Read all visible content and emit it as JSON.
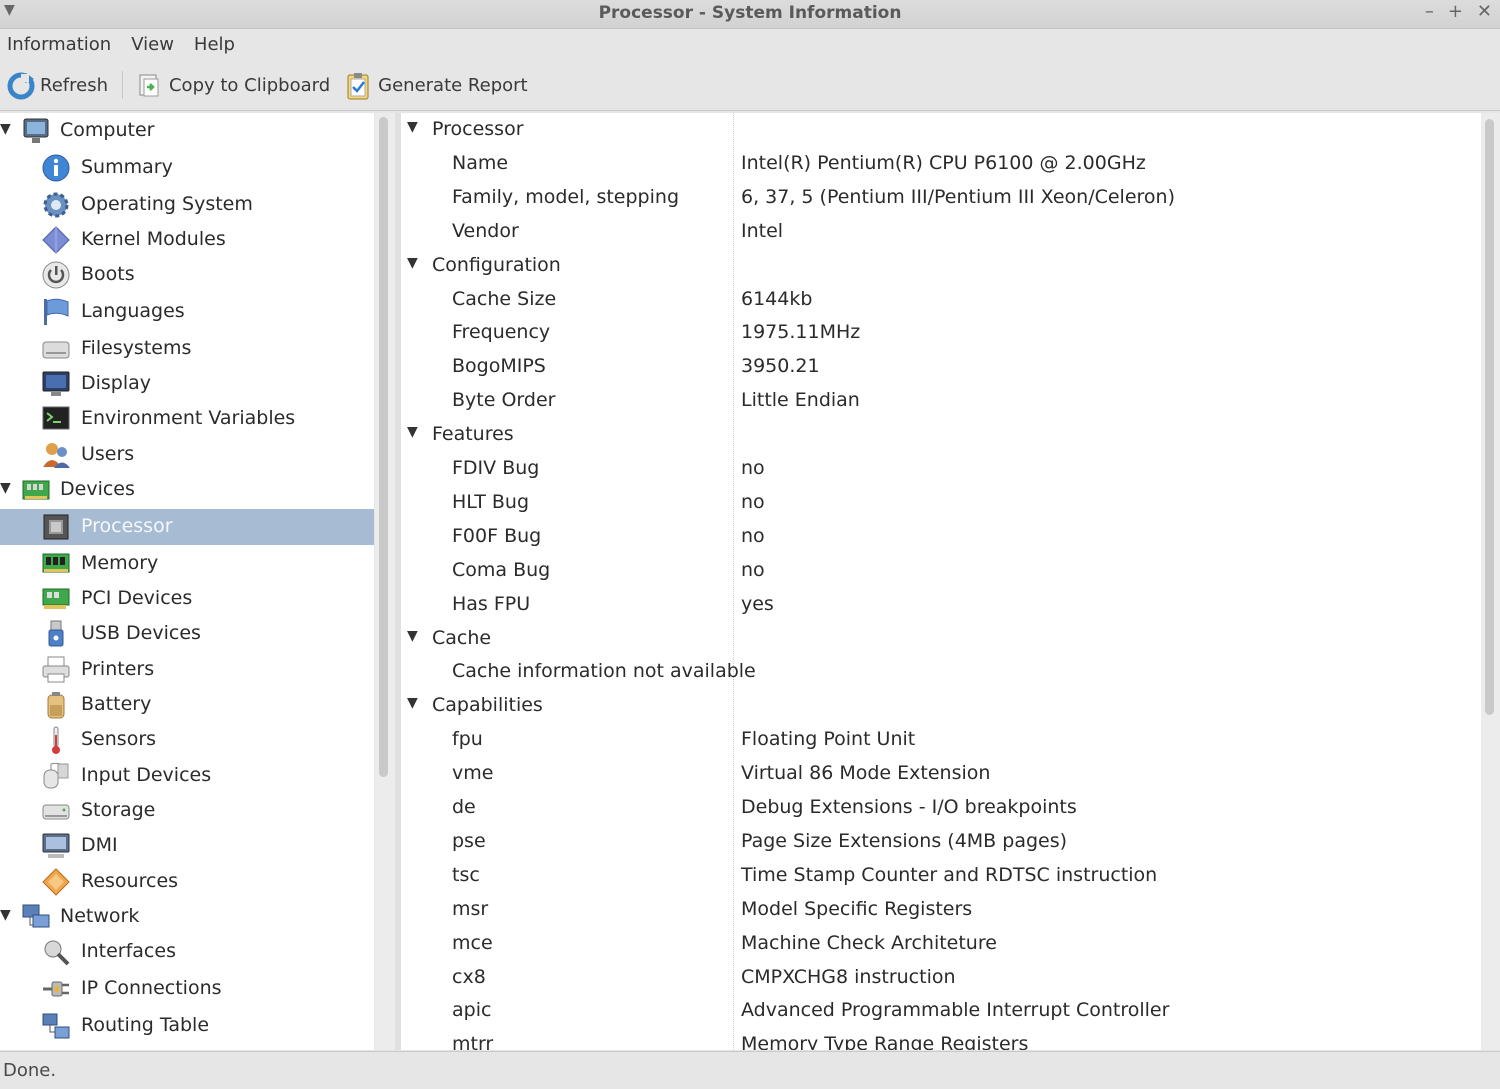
{
  "window": {
    "title": "Processor - System Information",
    "minimize": "–",
    "maximize": "+",
    "close": "✕"
  },
  "menu": [
    "Information",
    "View",
    "Help"
  ],
  "toolbar": {
    "refresh": "Refresh",
    "copy": "Copy to Clipboard",
    "report": "Generate Report"
  },
  "tree": [
    {
      "label": "Computer",
      "icon": "monitor-icon",
      "level": 0,
      "expanded": true
    },
    {
      "label": "Summary",
      "icon": "info-icon",
      "level": 1
    },
    {
      "label": "Operating System",
      "icon": "gear-icon",
      "level": 1
    },
    {
      "label": "Kernel Modules",
      "icon": "diamond-icon",
      "level": 1
    },
    {
      "label": "Boots",
      "icon": "power-icon",
      "level": 1
    },
    {
      "label": "Languages",
      "icon": "flag-icon",
      "level": 1
    },
    {
      "label": "Filesystems",
      "icon": "drive-icon",
      "level": 1
    },
    {
      "label": "Display",
      "icon": "display-icon",
      "level": 1
    },
    {
      "label": "Environment Variables",
      "icon": "terminal-icon",
      "level": 1
    },
    {
      "label": "Users",
      "icon": "users-icon",
      "level": 1
    },
    {
      "label": "Devices",
      "icon": "board-icon",
      "level": 0,
      "expanded": true
    },
    {
      "label": "Processor",
      "icon": "cpu-icon",
      "level": 1,
      "selected": true
    },
    {
      "label": "Memory",
      "icon": "memory-icon",
      "level": 1
    },
    {
      "label": "PCI Devices",
      "icon": "pci-icon",
      "level": 1
    },
    {
      "label": "USB Devices",
      "icon": "usb-icon",
      "level": 1
    },
    {
      "label": "Printers",
      "icon": "printer-icon",
      "level": 1
    },
    {
      "label": "Battery",
      "icon": "battery-icon",
      "level": 1
    },
    {
      "label": "Sensors",
      "icon": "thermometer-icon",
      "level": 1
    },
    {
      "label": "Input Devices",
      "icon": "input-device-icon",
      "level": 1
    },
    {
      "label": "Storage",
      "icon": "storage-icon",
      "level": 1
    },
    {
      "label": "DMI",
      "icon": "dmi-icon",
      "level": 1
    },
    {
      "label": "Resources",
      "icon": "resources-icon",
      "level": 1
    },
    {
      "label": "Network",
      "icon": "network-icon",
      "level": 0,
      "expanded": true
    },
    {
      "label": "Interfaces",
      "icon": "interfaces-icon",
      "level": 1
    },
    {
      "label": "IP Connections",
      "icon": "plug-icon",
      "level": 1
    },
    {
      "label": "Routing Table",
      "icon": "routing-icon",
      "level": 1
    }
  ],
  "details": [
    {
      "section": "Processor"
    },
    {
      "key": "Name",
      "value": "Intel(R) Pentium(R) CPU        P6100  @ 2.00GHz"
    },
    {
      "key": "Family, model, stepping",
      "value": "6, 37, 5 (Pentium III/Pentium III Xeon/Celeron)"
    },
    {
      "key": "Vendor",
      "value": "Intel"
    },
    {
      "section": "Configuration"
    },
    {
      "key": "Cache Size",
      "value": "6144kb"
    },
    {
      "key": "Frequency",
      "value": "1975.11MHz"
    },
    {
      "key": "BogoMIPS",
      "value": "3950.21"
    },
    {
      "key": "Byte Order",
      "value": "Little Endian"
    },
    {
      "section": "Features"
    },
    {
      "key": "FDIV Bug",
      "value": "no"
    },
    {
      "key": "HLT Bug",
      "value": "no"
    },
    {
      "key": "F00F Bug",
      "value": "no"
    },
    {
      "key": "Coma Bug",
      "value": "no"
    },
    {
      "key": "Has FPU",
      "value": "yes"
    },
    {
      "section": "Cache"
    },
    {
      "key": "Cache information not available",
      "value": ""
    },
    {
      "section": "Capabilities"
    },
    {
      "key": "fpu",
      "value": "Floating Point Unit"
    },
    {
      "key": "vme",
      "value": "Virtual 86 Mode Extension"
    },
    {
      "key": "de",
      "value": "Debug Extensions - I/O breakpoints"
    },
    {
      "key": "pse",
      "value": "Page Size Extensions (4MB pages)"
    },
    {
      "key": "tsc",
      "value": "Time Stamp Counter and RDTSC instruction"
    },
    {
      "key": "msr",
      "value": "Model Specific Registers"
    },
    {
      "key": "mce",
      "value": "Machine Check Architeture"
    },
    {
      "key": "cx8",
      "value": "CMPXCHG8 instruction"
    },
    {
      "key": "apic",
      "value": "Advanced Programmable Interrupt Controller"
    },
    {
      "key": "mtrr",
      "value": "Memory Type Range Registers"
    }
  ],
  "status": "Done.",
  "colors": {
    "selection": "#a7bbd3",
    "background": "#ffffff",
    "chrome": "#e6e6e6"
  }
}
